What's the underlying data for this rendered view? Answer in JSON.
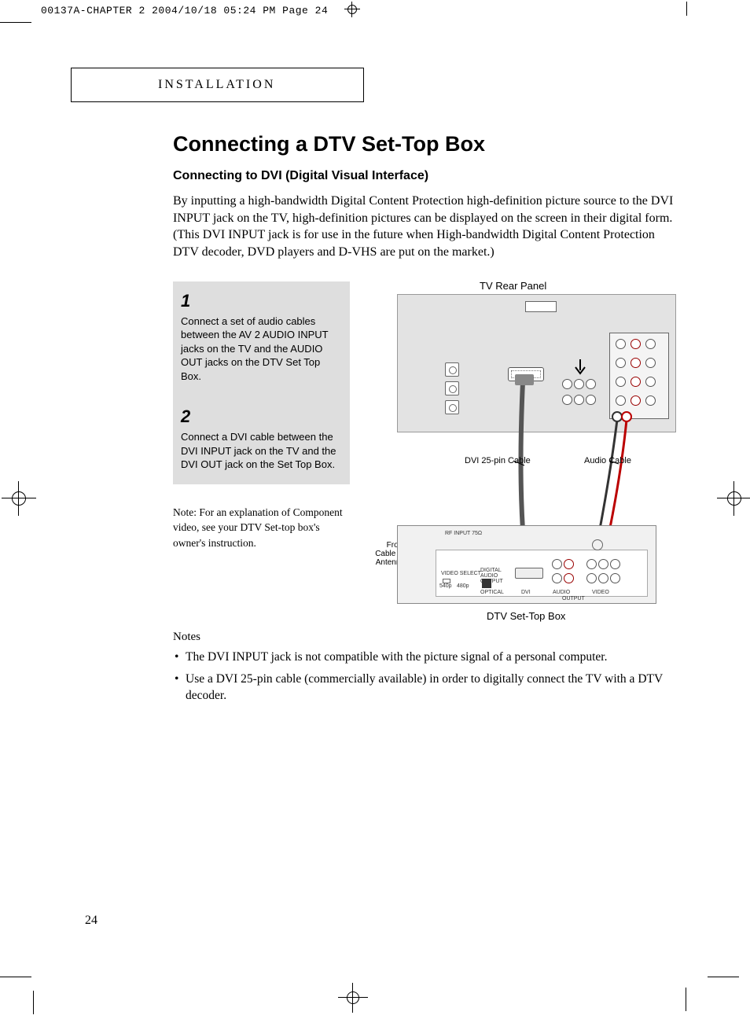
{
  "print_header": "00137A-CHAPTER 2  2004/10/18  05:24 PM  Page 24",
  "section_label": "INSTALLATION",
  "title": "Connecting a DTV Set-Top Box",
  "subtitle": "Connecting to DVI (Digital Visual Interface)",
  "body": "By inputting a high-bandwidth Digital Content Protection high-definition picture source to the DVI INPUT jack on the TV, high-definition pictures can be displayed on the screen in their digital form. (This DVI INPUT jack is for use in the future when High-bandwidth Digital Content Protection DTV decoder, DVD players and D-VHS are put on the market.)",
  "steps": [
    {
      "num": "1",
      "text": "Connect a set of audio cables between the AV 2 AUDIO INPUT jacks on the TV and the AUDIO OUT jacks on the DTV Set Top Box."
    },
    {
      "num": "2",
      "text": "Connect a DVI cable between the DVI INPUT jack on the TV and the DVI OUT jack on the Set Top Box."
    }
  ],
  "step_note": "Note: For an explanation of Component video, see your DTV Set-top box's owner's instruction.",
  "diagram": {
    "top_label": "TV Rear Panel",
    "dvi_cable_label": "DVI 25-pin Cable",
    "audio_cable_label": "Audio Cable",
    "from_cable_label": "From Cable or Antenna",
    "bottom_label": "DTV Set-Top Box",
    "stb_labels": {
      "rf": "RF INPUT 75Ω",
      "video_select": "VIDEO SELECT",
      "v1": "540p",
      "v2": "480p",
      "digital_audio": "DIGITAL AUDIO OUTPUT",
      "optical": "OPTICAL",
      "dvi": "DVI",
      "audio": "AUDIO",
      "video": "VIDEO",
      "output": "OUTPUT"
    }
  },
  "notes_heading": "Notes",
  "notes": [
    "The DVI INPUT jack is not compatible with the picture signal of a personal computer.",
    "Use a DVI 25-pin cable (commercially available) in order to digitally connect the TV with a DTV decoder."
  ],
  "page_number": "24"
}
